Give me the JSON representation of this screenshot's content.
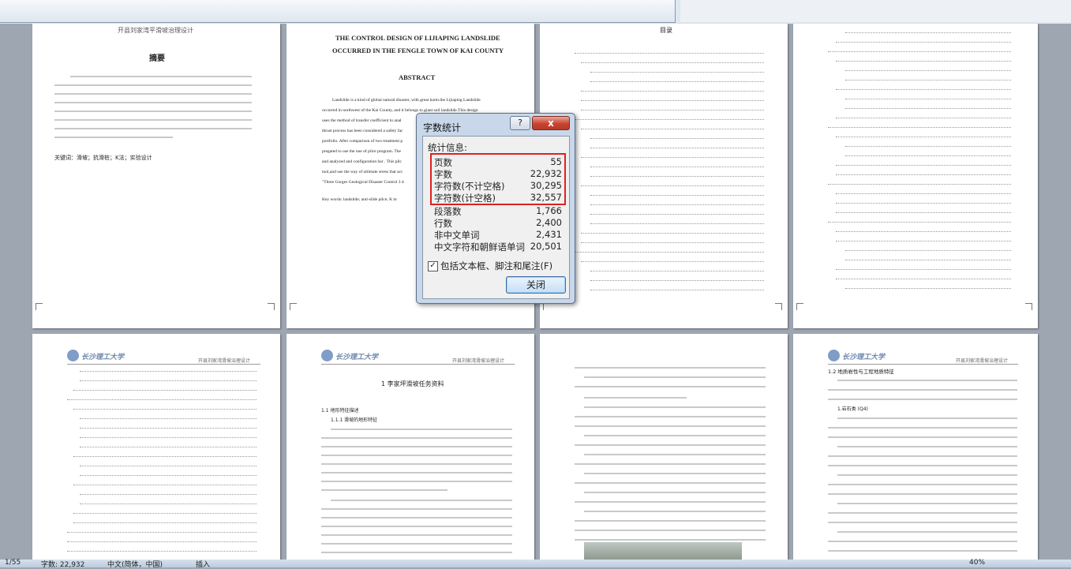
{
  "dialog": {
    "title": "字数统计",
    "help_label": "?",
    "close_x": "x",
    "section_label": "统计信息:",
    "stats": [
      {
        "label": "页数",
        "value": "55"
      },
      {
        "label": "字数",
        "value": "22,932"
      },
      {
        "label": "字符数(不计空格)",
        "value": "30,295"
      },
      {
        "label": "字符数(计空格)",
        "value": "32,557"
      },
      {
        "label": "段落数",
        "value": "1,766"
      },
      {
        "label": "行数",
        "value": "2,400"
      },
      {
        "label": "非中文单词",
        "value": "2,431"
      },
      {
        "label": "中文字符和朝鲜语单词",
        "value": "20,501"
      }
    ],
    "checkbox_label": "包括文本框、脚注和尾注(F)",
    "checkbox_checked": "✓",
    "close_button": "关闭"
  },
  "pages": {
    "p1": {
      "header": "开县刘家湾平滑坡治理设计",
      "title": "摘要",
      "keywords": "关键词：滑坡；抗滑桩；K法；实验设计"
    },
    "p2": {
      "title_line1": "THE CONTROL DESIGN OF LIJIAPING LANDSLIDE",
      "title_line2": "OCCURRED IN THE FENGLE TOWN OF KAI COUNTY",
      "abstract_heading": "ABSTRACT",
      "para_lines": [
        "Landslide is a kind of global natural disaster, with great harm.the Lijiaping Landslide",
        "occurred in northwest of the Kai County, and it belongs to giant soil landslide.This design",
        "uses the method of transfer coefficient to anal",
        "thrust process has been considered a safety fac",
        "portfolio. After comparison of two treatment p",
        "pregated to use the one of pilce program. The",
        "and analyzed and configuration bar . This pilc",
        "tool,and use the way of ultimate stress that acc",
        "\"Three Gorges Geological Disaster Control 3 d"
      ],
      "keywords": "Key words: landslide; anti-slide pilce; K m"
    },
    "p3": {
      "title": "目录"
    },
    "p6": {
      "chapter_title": "1 李家坪滑坡任务资料",
      "s1": "1.1 地形特征描述",
      "s2": "1.1.1 滑坡的地形特征"
    },
    "p8": {
      "section": "1.2 地质岩性与工程地质特征",
      "sub": "1.岩石类 (Q4)"
    },
    "university": "长沙理工大学",
    "running_header": "开县刘家湾滑坡治理设计"
  },
  "statusbar": {
    "page": "1/55",
    "words": "字数: 22,932",
    "language": "中文(简体，中国)",
    "mode": "插入",
    "zoom": "40%"
  }
}
